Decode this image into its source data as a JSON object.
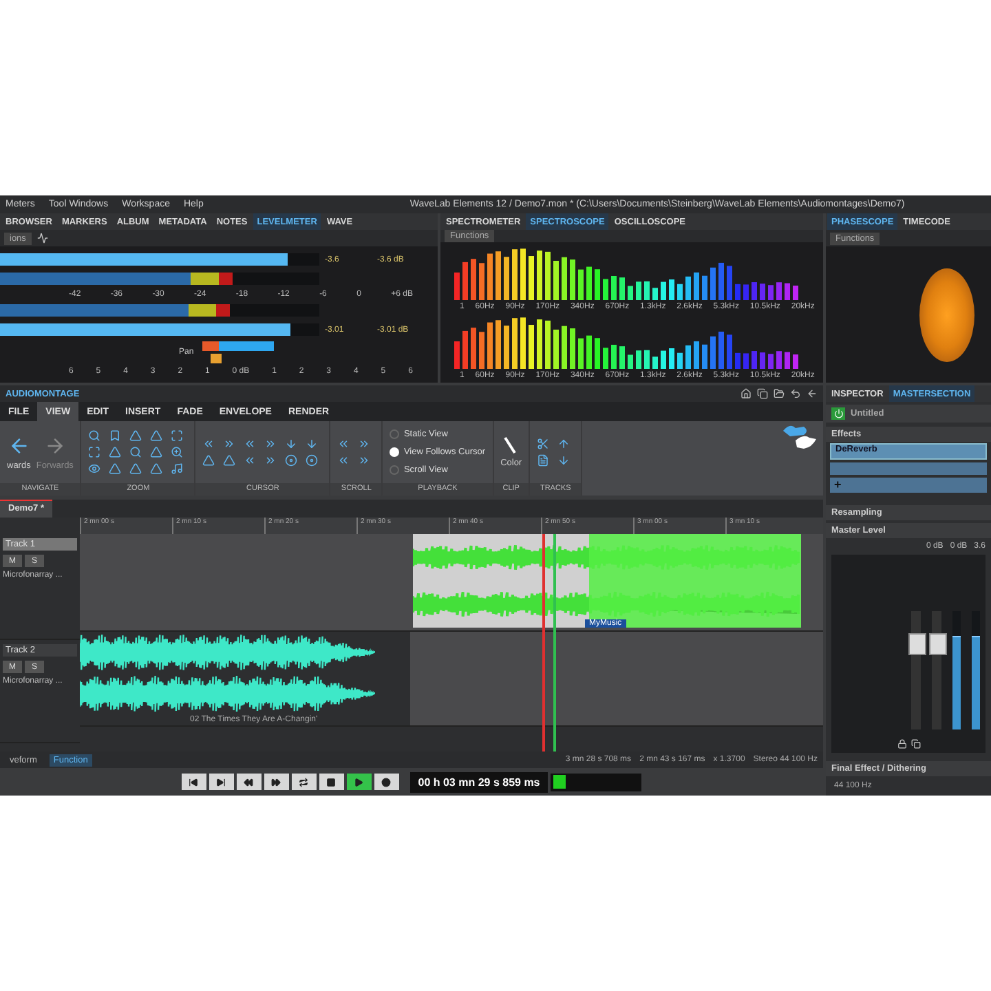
{
  "menu": [
    "Meters",
    "Tool Windows",
    "Workspace",
    "Help"
  ],
  "window": {
    "title": "WaveLab Elements 12 / Demo7.mon * (C:\\Users\\Documents\\Steinberg\\WaveLab Elements\\Audiomontages\\Demo7)"
  },
  "left_panel": {
    "tabs": [
      {
        "label": "BROWSER",
        "selected": false
      },
      {
        "label": "MARKERS",
        "selected": false
      },
      {
        "label": "ALBUM",
        "selected": false
      },
      {
        "label": "METADATA",
        "selected": false
      },
      {
        "label": "NOTES",
        "selected": false
      },
      {
        "label": "LEVELMETER",
        "selected": true
      },
      {
        "label": "WAVE",
        "selected": false
      }
    ],
    "functions": "ions",
    "level_meter": {
      "channels": [
        {
          "peak_meter": {
            "level": 0.9
          },
          "rms_meter": {
            "level": 0.73
          },
          "reading": "-3.6",
          "peak": "-3.6 dB"
        },
        {
          "peak_meter": {
            "level": 0.91
          },
          "rms_meter": {
            "level": 0.72
          },
          "reading": "-3.01",
          "peak": "-3.01 dB"
        }
      ],
      "scale": [
        "-42",
        "-36",
        "-30",
        "-24",
        "-18",
        "-12",
        "-6",
        "0",
        "+6 dB"
      ],
      "pan_label": "Pan",
      "pan_scale": [
        "6",
        "5",
        "4",
        "3",
        "2",
        "1",
        "0 dB",
        "1",
        "2",
        "3",
        "4",
        "5",
        "6"
      ]
    }
  },
  "middle_panel": {
    "tabs": [
      {
        "label": "SPECTROMETER",
        "selected": false
      },
      {
        "label": "SPECTROSCOPE",
        "selected": true
      },
      {
        "label": "OSCILLOSCOPE",
        "selected": false
      }
    ],
    "functions": "Functions",
    "channels": [
      {
        "freq_labels": [
          "1",
          "60Hz",
          "90Hz",
          "170Hz",
          "340Hz",
          "670Hz",
          "1.3kHz",
          "2.6kHz",
          "5.3kHz",
          "10.5kHz",
          "20kHz"
        ]
      },
      {
        "freq_labels": [
          "1",
          "60Hz",
          "90Hz",
          "170Hz",
          "340Hz",
          "670Hz",
          "1.3kHz",
          "2.6kHz",
          "5.3kHz",
          "10.5kHz",
          "20kHz"
        ]
      }
    ]
  },
  "right_panel": {
    "tabs": [
      {
        "label": "PHASESCOPE",
        "selected": true
      },
      {
        "label": "TIMECODE",
        "selected": false
      }
    ],
    "functions": "Functions"
  },
  "montage": {
    "title": "AUDIOMONTAGE",
    "ribbon_tabs": [
      {
        "label": "FILE",
        "selected": false
      },
      {
        "label": "VIEW",
        "selected": true
      },
      {
        "label": "EDIT",
        "selected": false
      },
      {
        "label": "INSERT",
        "selected": false
      },
      {
        "label": "FADE",
        "selected": false
      },
      {
        "label": "ENVELOPE",
        "selected": false
      },
      {
        "label": "RENDER",
        "selected": false
      }
    ],
    "groups": [
      {
        "label": "NAVIGATE",
        "kind": "navigate",
        "buttons": [
          "wards",
          "Forwards"
        ]
      },
      {
        "label": "ZOOM",
        "kind": "zoom"
      },
      {
        "label": "CURSOR",
        "kind": "cursor"
      },
      {
        "label": "SCROLL",
        "kind": "scroll"
      },
      {
        "label": "PLAYBACK",
        "kind": "options",
        "options": [
          {
            "label": "Static View",
            "selected": false
          },
          {
            "label": "View Follows Cursor",
            "selected": true
          },
          {
            "label": "Scroll View",
            "selected": false
          }
        ]
      },
      {
        "label": "CLIP",
        "kind": "color",
        "button": "Color"
      },
      {
        "label": "TRACKS",
        "kind": "tracks"
      }
    ],
    "document_tab": "Demo7 *",
    "ruler": [
      "2 mn 00 s",
      "2 mn 10 s",
      "2 mn 20 s",
      "2 mn 30 s",
      "2 mn 40 s",
      "2 mn 50 s",
      "3 mn 00 s",
      "3 mn 10 s"
    ],
    "tracks": [
      {
        "name": "Track 1",
        "selected": true,
        "buttons": [
          "M",
          "S"
        ],
        "input": "Microfonarray ..."
      },
      {
        "name": "Track 2",
        "selected": false,
        "buttons": [
          "M",
          "S"
        ],
        "input": "Microfonarray ..."
      }
    ],
    "clip_title": "02 The Times They Are A-Changin'",
    "clip_label": "MyMusic",
    "view_tabs": [
      {
        "label": "veform",
        "selected": false
      },
      {
        "label": "Function",
        "selected": true
      }
    ],
    "status": [
      "3 mn 28 s 708 ms",
      "2 mn 43 s 167 ms",
      "x 1.3700",
      "Stereo 44 100 Hz"
    ],
    "transport": {
      "buttons": [
        {
          "kind": "start",
          "selected": false
        },
        {
          "kind": "end",
          "selected": false
        },
        {
          "kind": "rewind",
          "selected": false
        },
        {
          "kind": "forward",
          "selected": false
        },
        {
          "kind": "loop",
          "selected": false
        },
        {
          "kind": "stop",
          "selected": false
        },
        {
          "kind": "play",
          "selected": true
        },
        {
          "kind": "record",
          "selected": false
        }
      ],
      "time": "00 h 03 mn 29 s 859 ms"
    }
  },
  "inspector": {
    "tabs": [
      {
        "label": "INSPECTOR",
        "selected": false
      },
      {
        "label": "MASTERSECTION",
        "selected": true
      }
    ],
    "preset": {
      "name": "Untitled",
      "on": true
    },
    "effects_label": "Effects",
    "effects": [
      "DeReverb"
    ],
    "add": "+",
    "resampling": "Resampling",
    "master_level": "Master Level",
    "readings": [
      "0 dB",
      "0 dB",
      "3.6"
    ],
    "meters": [
      {
        "level": 0.78
      },
      {
        "level": 0.78
      }
    ],
    "final": "Final Effect / Dithering",
    "rate": "44 100 Hz"
  }
}
